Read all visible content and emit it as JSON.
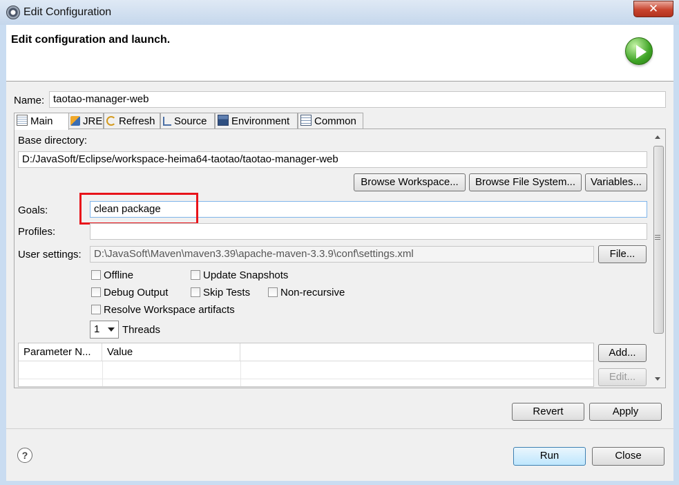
{
  "window": {
    "title": "Edit Configuration",
    "close_glyph": "✕"
  },
  "header": {
    "title": "Edit configuration and launch.",
    "icon": "run-icon"
  },
  "name_field": {
    "label": "Name:",
    "value": "taotao-manager-web"
  },
  "tabs": [
    {
      "label": "Main",
      "icon": "main-tab-icon",
      "active": true
    },
    {
      "label": "JRE",
      "icon": "jre-icon"
    },
    {
      "label": "Refresh",
      "icon": "refresh-icon"
    },
    {
      "label": "Source",
      "icon": "source-icon"
    },
    {
      "label": "Environment",
      "icon": "environment-icon"
    },
    {
      "label": "Common",
      "icon": "common-icon"
    }
  ],
  "main": {
    "base_directory_label": "Base directory:",
    "base_directory_value": "D:/JavaSoft/Eclipse/workspace-heima64-taotao/taotao-manager-web",
    "browse_workspace": "Browse Workspace...",
    "browse_filesystem": "Browse File System...",
    "variables": "Variables...",
    "goals_label": "Goals:",
    "goals_value": "clean package",
    "profiles_label": "Profiles:",
    "profiles_value": "",
    "user_settings_label": "User settings:",
    "user_settings_value": "D:\\JavaSoft\\Maven\\maven3.39\\apache-maven-3.3.9\\conf\\settings.xml",
    "file_button": "File...",
    "checkboxes": {
      "offline": "Offline",
      "update_snapshots": "Update Snapshots",
      "debug_output": "Debug Output",
      "skip_tests": "Skip Tests",
      "non_recursive": "Non-recursive",
      "resolve_workspace": "Resolve Workspace artifacts"
    },
    "threads_value": "1",
    "threads_label": "Threads",
    "table": {
      "columns": [
        "Parameter N...",
        "Value"
      ]
    },
    "add_button": "Add...",
    "edit_button": "Edit..."
  },
  "footer": {
    "revert": "Revert",
    "apply": "Apply",
    "run": "Run",
    "close": "Close",
    "help_glyph": "?"
  },
  "colors": {
    "highlight_box": "#e8131a",
    "run_icon": "#3fa426"
  }
}
